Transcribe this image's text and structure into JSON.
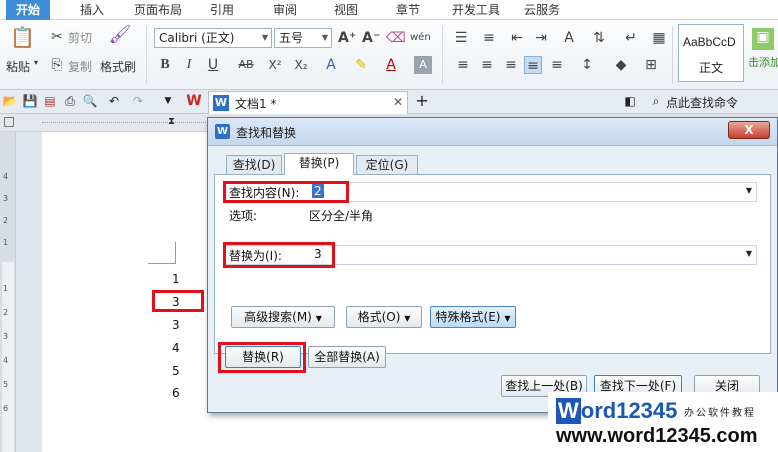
{
  "menu": {
    "tabs": [
      {
        "label": "开始",
        "active": true
      },
      {
        "label": "插入"
      },
      {
        "label": "页面布局"
      },
      {
        "label": "引用"
      },
      {
        "label": "审阅"
      },
      {
        "label": "视图"
      },
      {
        "label": "章节"
      },
      {
        "label": "开发工具"
      },
      {
        "label": "云服务"
      }
    ]
  },
  "ribbon": {
    "paste_label": "粘贴",
    "cut_label": "剪切",
    "copy_label": "复制",
    "format_painter_label": "格式刷",
    "font_name": "Calibri (正文)",
    "font_size": "五号",
    "style_preview": "AaBbCcD",
    "style_name": "正文",
    "side_label": "击添加"
  },
  "quickbar": {
    "doc_tab_title": "文档1 *",
    "search_label": "点此查找命令"
  },
  "document": {
    "lines": [
      "1",
      "3",
      "3",
      "4",
      "5",
      "6"
    ],
    "ruler_numbers": [
      "4",
      "3",
      "2",
      "1",
      "1",
      "2",
      "3",
      "4",
      "5",
      "6"
    ]
  },
  "dialog": {
    "title": "查找和替换",
    "close_label": "X",
    "tabs": [
      {
        "label": "查找(D)"
      },
      {
        "label": "替换(P)",
        "active": true
      },
      {
        "label": "定位(G)"
      }
    ],
    "find_label": "查找内容(N):",
    "find_value": "2",
    "options_label": "选项:",
    "options_value": "区分全/半角",
    "replace_label": "替换为(I):",
    "replace_value": "3",
    "buttons": {
      "advanced": "高级搜索(M)",
      "format": "格式(O)",
      "special": "特殊格式(E)",
      "replace": "替换(R)",
      "replace_all": "全部替换(A)",
      "find_prev": "查找上一处(B)",
      "find_next": "查找下一处(F)",
      "close": "关闭"
    }
  },
  "watermark": {
    "logo_w": "W",
    "logo_rest": "ord12345",
    "subtitle": "办公软件教程",
    "url": "www.word12345.com"
  },
  "colors": {
    "accent": "#3f8dd7",
    "highlight_red": "#e3101a",
    "watermark_blue": "#1c57b8"
  }
}
